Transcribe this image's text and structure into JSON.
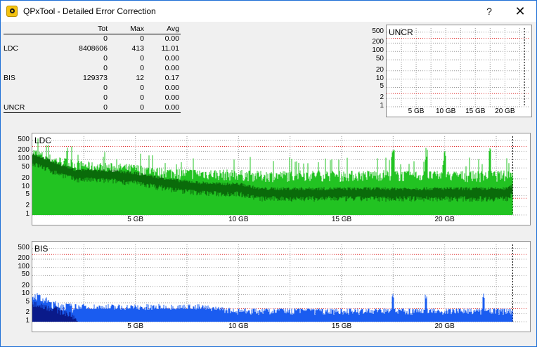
{
  "window": {
    "title": "QPxTool - Detailed Error Correction",
    "help": "?",
    "close": "✕"
  },
  "stats": {
    "headers": [
      "Tot",
      "Max",
      "Avg"
    ],
    "rows": [
      {
        "label": "",
        "tot": "0",
        "max": "0",
        "avg": "0.00"
      },
      {
        "label": "LDC",
        "tot": "8408606",
        "max": "413",
        "avg": "11.01"
      },
      {
        "label": "",
        "tot": "0",
        "max": "0",
        "avg": "0.00"
      },
      {
        "label": "",
        "tot": "0",
        "max": "0",
        "avg": "0.00"
      },
      {
        "label": "BIS",
        "tot": "129373",
        "max": "12",
        "avg": "0.17"
      },
      {
        "label": "",
        "tot": "0",
        "max": "0",
        "avg": "0.00"
      },
      {
        "label": "",
        "tot": "0",
        "max": "0",
        "avg": "0.00"
      },
      {
        "label": "UNCR",
        "tot": "0",
        "max": "0",
        "avg": "0.00"
      }
    ]
  },
  "chart_data": [
    {
      "type": "area",
      "title": "UNCR",
      "yticks": [
        "500",
        "200",
        "100",
        "50",
        "20",
        "10",
        "5",
        "2",
        "1"
      ],
      "xticks": [
        "5 GB",
        "10 GB",
        "15 GB",
        "20 GB"
      ],
      "ylim": [
        1,
        500
      ],
      "yscale": "log",
      "xlim_gb": [
        0,
        24
      ],
      "end_gb": 23.3,
      "threshold_lines": [
        3,
        300
      ],
      "series": [
        {
          "values": []
        }
      ],
      "colors": {
        "fill": "#22c322",
        "threshold": "#e03030"
      }
    },
    {
      "type": "area",
      "title": "LDC",
      "yticks": [
        "500",
        "200",
        "100",
        "50",
        "20",
        "10",
        "5",
        "2",
        "1"
      ],
      "xticks": [
        "5 GB",
        "10 GB",
        "15 GB",
        "20 GB"
      ],
      "ylim": [
        1,
        500
      ],
      "yscale": "log",
      "xlim_gb": [
        0,
        24
      ],
      "end_gb": 23.3,
      "threshold_lines": [
        4,
        300
      ],
      "series": [
        {
          "x": [
            0,
            0.5,
            1,
            2,
            3,
            4,
            5,
            6,
            7,
            8,
            9,
            10,
            11,
            12,
            13,
            14,
            15,
            16,
            17,
            18,
            19,
            20,
            21,
            22,
            23,
            23.3
          ],
          "values": [
            150,
            110,
            80,
            55,
            45,
            42,
            38,
            30,
            27,
            26,
            25,
            24,
            22,
            22,
            23,
            23,
            22,
            23,
            24,
            22,
            22,
            22,
            22,
            22,
            23,
            24
          ]
        },
        {
          "x": [
            0,
            0.5,
            1,
            2,
            3,
            4,
            5,
            6,
            7,
            8,
            9,
            10,
            11,
            12,
            13,
            14,
            15,
            16,
            17,
            18,
            19,
            20,
            21,
            22,
            23,
            23.3
          ],
          "values": [
            110,
            80,
            55,
            30,
            28,
            26,
            22,
            16,
            12,
            10,
            9,
            9,
            6,
            6,
            6,
            6,
            6,
            6,
            6,
            6,
            6,
            6,
            6,
            6,
            6,
            8
          ]
        }
      ],
      "spikes_gb": [
        17.5,
        19.1,
        20.0,
        22.2
      ],
      "colors": {
        "fill": "#22c322",
        "avg": "#0a6b0a",
        "threshold": "#e03030"
      }
    },
    {
      "type": "area",
      "title": "BIS",
      "yticks": [
        "500",
        "200",
        "100",
        "50",
        "20",
        "10",
        "5",
        "2",
        "1"
      ],
      "xticks": [
        "5 GB",
        "10 GB",
        "15 GB",
        "20 GB"
      ],
      "ylim": [
        1,
        500
      ],
      "yscale": "log",
      "xlim_gb": [
        0,
        24
      ],
      "end_gb": 23.3,
      "threshold_lines": [
        3,
        300
      ],
      "series": [
        {
          "x": [
            0,
            0.5,
            1,
            2,
            3,
            5,
            8,
            10,
            15,
            20,
            23.3
          ],
          "values": [
            9,
            6,
            4,
            3,
            3,
            3,
            3,
            2,
            2,
            2,
            2
          ]
        }
      ],
      "spikes_gb": [
        17.5,
        19.1,
        21.9
      ],
      "colors": {
        "fill": "#1a5cf0",
        "dark": "#0a1a8a",
        "threshold": "#e03030"
      }
    }
  ]
}
